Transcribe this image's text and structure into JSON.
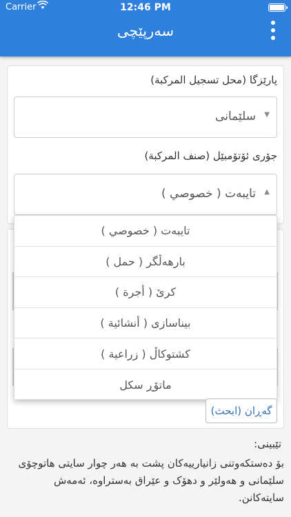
{
  "status_bar": {
    "carrier": "Carrier",
    "time": "12:46 PM"
  },
  "header": {
    "title": "سەرپێچی"
  },
  "form": {
    "province": {
      "label": "پارێزگا (محل تسجيل المركبة)",
      "value": "سلێمانی"
    },
    "vehicle_type": {
      "label": "جۆری ئۆتۆمبێل (صنف المركبة)",
      "value": "تایبەت ( خصوصي )"
    }
  },
  "dropdown": {
    "options": [
      "تایبەت ( خصوصي )",
      "بارهەڵگر ( حمل )",
      "کرێ ( أجرة )",
      "بیناسازی ( أنشائية )",
      "کشتوکاڵ ( زراعية )",
      "ماتۆڕ سكل"
    ]
  },
  "search_button": "گەڕان (ابحث)",
  "note": {
    "title": "تێبینی:",
    "text": "بۆ دەستکەوتنی زانیارییەکان پشت بە هەر چوار سایتی هاتوچۆی سلێمانی و هەولێر و دهۆک و عێراق بەستراوە، ئەمەش سایتەکانن."
  }
}
